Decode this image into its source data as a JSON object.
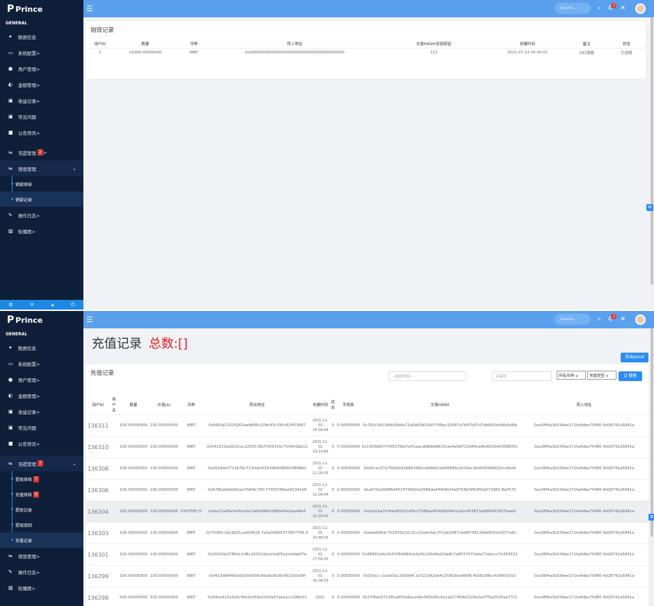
{
  "brand": "Prince",
  "section_general": "GENERAL",
  "topbar": {
    "search_placeholder": "Search...",
    "notif_count": "2"
  },
  "shot1": {
    "nav": [
      {
        "label": "数据信息",
        "icon": "dashboard-icon"
      },
      {
        "label": "系统配置>",
        "icon": "monitor-icon"
      },
      {
        "label": "用户管理>",
        "icon": "user-icon"
      },
      {
        "label": "金额管理>",
        "icon": "money-icon"
      },
      {
        "label": "收益记录>",
        "icon": "record-icon"
      },
      {
        "label": "常见问题",
        "icon": "question-icon"
      },
      {
        "label": "公告快讯>",
        "icon": "notice-icon"
      },
      {
        "label": "充提管理",
        "badge": "2",
        "suffix": ">",
        "icon": "exchange-icon"
      },
      {
        "label": "销毁管理",
        "icon": "exchange-icon"
      },
      {
        "label": "操作日志>",
        "icon": "edit-icon"
      },
      {
        "label": "轮播图>",
        "icon": "image-icon"
      }
    ],
    "sub": [
      "销毁审核",
      "销毁记录"
    ],
    "card_title": "销毁记录",
    "headers": [
      "用户ID",
      "数量",
      "币种",
      "转入地址",
      "交易HASH/驳回原因",
      "创建时间",
      "备注",
      "状态"
    ],
    "row": [
      "1",
      "14399.00000000",
      "WBT",
      "0x000000000000000000000000000000000000000",
      "123",
      "2021-07-13 00:00:01",
      "分红销毁",
      "已到账"
    ]
  },
  "shot2": {
    "nav": [
      {
        "label": "数据信息",
        "icon": "dashboard-icon"
      },
      {
        "label": "系统配置>",
        "icon": "monitor-icon"
      },
      {
        "label": "用户管理>",
        "icon": "user-icon"
      },
      {
        "label": "金额管理>",
        "icon": "money-icon"
      },
      {
        "label": "收益记录>",
        "icon": "record-icon"
      },
      {
        "label": "常见问题",
        "icon": "question-icon"
      },
      {
        "label": "公告快讯>",
        "icon": "notice-icon"
      },
      {
        "label": "充提管理",
        "badge": "7",
        "icon": "exchange-icon"
      }
    ],
    "sub": [
      {
        "label": "提现审核",
        "badge": "7"
      },
      {
        "label": "充值审核",
        "badge": "0"
      },
      {
        "label": "提现记录"
      },
      {
        "label": "提现驳回"
      },
      {
        "label": "充值记录"
      }
    ],
    "nav_after": [
      {
        "label": "销毁管理>",
        "icon": "exchange-icon"
      },
      {
        "label": "操作日志>",
        "icon": "edit-icon"
      },
      {
        "label": "轮播图>",
        "icon": "image-icon"
      }
    ],
    "page_title": "充值记录",
    "total_label": "总数:[]",
    "export_label": "导出excel",
    "card_title": "充值记录",
    "date_placeholder": "--选择时间--",
    "keyword_placeholder": "关键字",
    "coin_select": "所有币种 ∨",
    "type_select": "充值类型 ∨",
    "search_btn": "Q 搜索",
    "headers": [
      "用户ID",
      "用户名",
      "数量",
      "价值($)",
      "币种",
      "转出地址",
      "创建时间",
      "状态",
      "手续费",
      "交易HASH",
      "转入地址"
    ],
    "rows": [
      [
        "136311",
        "100.00000000",
        "100.00000000",
        "WBT",
        "0x69f3a11025902aab806c328c43c395c61ff53697",
        "2021-11-02 18:34:04",
        "0",
        "0.00000000",
        "0x782c3d22bfb30d4a72a0b60d02b570f8ac32647a7b97b97d7db692dcb8a5d9b",
        "0xa38f4a3b334ee171fa4dbe75480 4d28742a5841a"
      ],
      [
        "136310",
        "100.00000000",
        "100.00000000",
        "WBT",
        "0x042522ab923cec32055 8b7f164316c750943bb12",
        "2021-11-02 19:14:04",
        "0",
        "0.00000000",
        "0x1303b6077f0527fbb7a41aacdb8fbb6815cee4e9d723d49ce8fe8d304d358655c",
        "0xa38f4a3b334ee171fa4dbe75480 4d28742a5841a"
      ],
      [
        "136308",
        "100.00000000",
        "100.00000000",
        "WBT",
        "0xe918eb3713b76c713fadc6353d640869cf3898b0",
        "2021-11-02 12:28:03",
        "0",
        "0.00000000",
        "0xb5ca237a7f0b5b42666166e1db8bb2a540894ca524ac3bd05dfe6832fcc4ed5",
        "0xa38f4a3b334ee171fa4dbe75480 4d28742a5841a"
      ],
      [
        "136306",
        "100.00000000",
        "100.00000000",
        "WBT",
        "0x678b2bbdd91ee7fd09c79fc7745678bee91341d9",
        "2021-11-02 12:26:04",
        "0",
        "0.00000000",
        "0xa670e1b686d453479542ef2589da444fd024a9754bf3f63f6fa573960 8a0570",
        "0xa38f4a3b334ee171fa4dbe75480 4d28742a5841a"
      ],
      [
        "136304",
        "100.00000000",
        "100.00000000",
        "USDTHECO",
        "0x6e27a46a5ef4ce9a7a6fe94fb1988e04a3ae46a5",
        "2021-11-02 10:29:55",
        "0",
        "0.00000000",
        "0xd1bcba7fc84a6f015c45b27586ae854b9d3441ce0c453873a9f804318f7feab0",
        "0xa38f4a3b334ee171fa4dbe75480 4d28742a5841a"
      ],
      [
        "136303",
        "100.00000000",
        "100.00000000",
        "WBT",
        "0x7936fc19c3b01ced59614 7a3a30665377847766 0",
        "2021-11-01 23:46:03",
        "0",
        "0.00000000",
        "0xebe606dc7032ff3a32c21c23a4c0ac701db3087cafd8758134ab9f10e3257a6c",
        "0xa38f4a3b334ee171fa4dbe75480 4d28742a5841a"
      ],
      [
        "136301",
        "100.00000000",
        "100.00000000",
        "WBT",
        "0x015d3b3786dc1d8cd3252dace3a6f5e1ce9ab07e",
        "2021-11-01 17:56:05",
        "0",
        "0.00000000",
        "0x48991b4e342f1f64460cb2e5b249c8ed24a8c7e8537072dda73deccc7a383531",
        "0xa38f4a3b334ee171fa4dbe75480 4d28742a5841a"
      ],
      [
        "136299",
        "100.00000000",
        "100.00000000",
        "WBT",
        "0xf413d66490ddd7b0058c90a8a9f28c4510d3ef9f",
        "2021-11-01 16:36:53",
        "0",
        "0.00000000",
        "0x07bcc c1dcb0a12d0994 2a722342eb4c2f78a5ee9906 4d38298ccfc06fcf101c",
        "0xa38f4a3b334ee171fa4dbe75480 4d28742a5841a"
      ],
      [
        "136298",
        "500.00000000",
        "500.00000000",
        "WBT",
        "0x69ce915e3a5cf6d2e359a2020a97aea1cc298e33",
        "2021-",
        "0",
        "0.00000000",
        "0x27f6ae371391a8f2fa6ace4dc063e56c4a1a027454e1f24a2ad7f3a2435aa77c1",
        "0xa38f4a3b334ee171fa4dbe75480 4d28742a5841a"
      ]
    ]
  }
}
